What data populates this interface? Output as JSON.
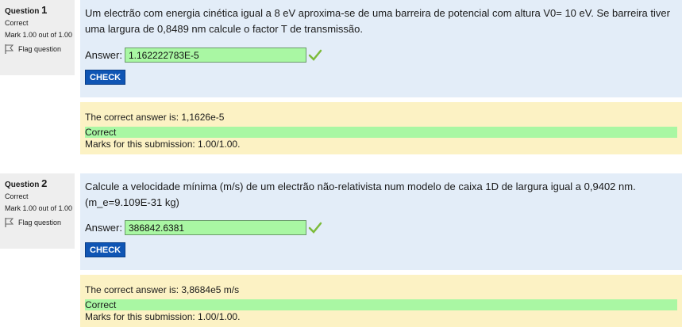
{
  "questions": [
    {
      "label": "Question",
      "number": "1",
      "state": "Correct",
      "grade": "Mark 1.00 out of 1.00",
      "flag_label": "Flag question",
      "text": "Um electrão com energia cinética igual a 8 eV aproxima-se de uma barreira de potencial com altura V0= 10 eV. Se barreira tiver uma largura de 0,8489 nm calcule o factor T de transmissão.",
      "answer_label": "Answer:",
      "answer_value": "1.162222783E-5",
      "check_label": "CHECK",
      "right_answer": "The correct answer is: 1,1626e-5",
      "feedback": "Correct",
      "marks": "Marks for this submission: 1.00/1.00."
    },
    {
      "label": "Question",
      "number": "2",
      "state": "Correct",
      "grade": "Mark 1.00 out of 1.00",
      "flag_label": "Flag question",
      "text": "Calcule a velocidade mínima (m/s) de um electrão não-relativista num modelo de caixa 1D de largura igual a 0,9402 nm. (m_e=9.109E-31 kg)",
      "answer_label": "Answer:",
      "answer_value": "386842.6381",
      "check_label": "CHECK",
      "right_answer": "The correct answer is: 3,8684e5 m/s",
      "feedback": "Correct",
      "marks": "Marks for this submission: 1.00/1.00."
    }
  ],
  "colors": {
    "info_bg": "#eeeeee",
    "formulation_bg": "#e3edf8",
    "outcome_bg": "#fcf2c4",
    "correct_green": "#a9f7a3",
    "check_button": "#0f55b4",
    "tick": "#7cbb3a"
  },
  "icons": {
    "flag": "flag-icon",
    "correct": "check-mark-icon"
  }
}
